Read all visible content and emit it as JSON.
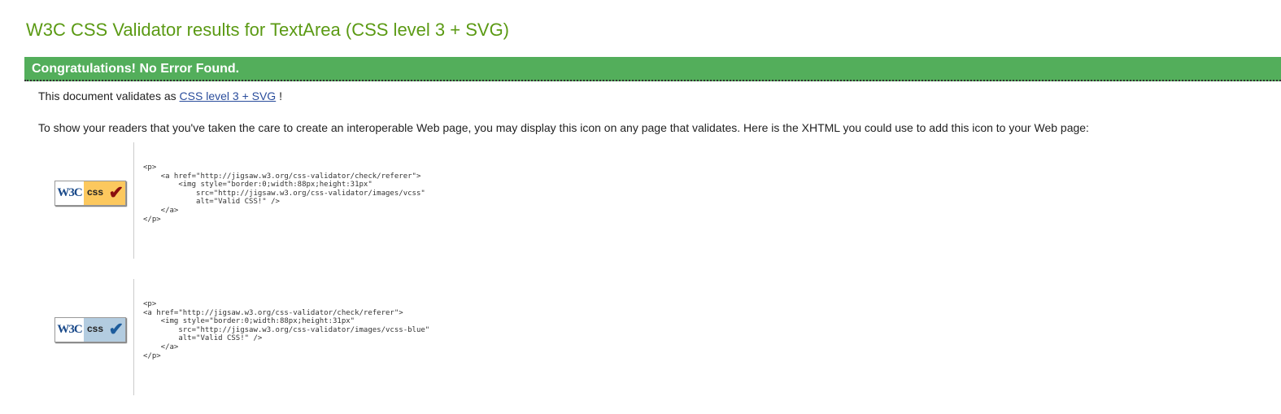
{
  "title": "W3C CSS Validator results for TextArea (CSS level 3 + SVG)",
  "banner": "Congratulations! No Error Found.",
  "validates": {
    "prefix": "This document validates as ",
    "link": "CSS level 3 + SVG",
    "suffix": " !"
  },
  "info": "To show your readers that you've taken the care to create an interoperable Web page, you may display this icon on any page that validates. Here is the XHTML you could use to add this icon to your Web page:",
  "badges": [
    {
      "w3c": "W3C",
      "css": "css",
      "bg": "#fcc85e",
      "check": "#8b0f0f"
    },
    {
      "w3c": "W3C",
      "css": "css",
      "bg": "#b3cce0",
      "check": "#1d5c9c"
    }
  ],
  "code_gold": "<p>\n    <a href=\"http://jigsaw.w3.org/css-validator/check/referer\">\n        <img style=\"border:0;width:88px;height:31px\"\n            src=\"http://jigsaw.w3.org/css-validator/images/vcss\"\n            alt=\"Valid CSS!\" />\n    </a>\n</p>",
  "code_blue": "<p>\n<a href=\"http://jigsaw.w3.org/css-validator/check/referer\">\n    <img style=\"border:0;width:88px;height:31px\"\n        src=\"http://jigsaw.w3.org/css-validator/images/vcss-blue\"\n        alt=\"Valid CSS!\" />\n    </a>\n</p>"
}
